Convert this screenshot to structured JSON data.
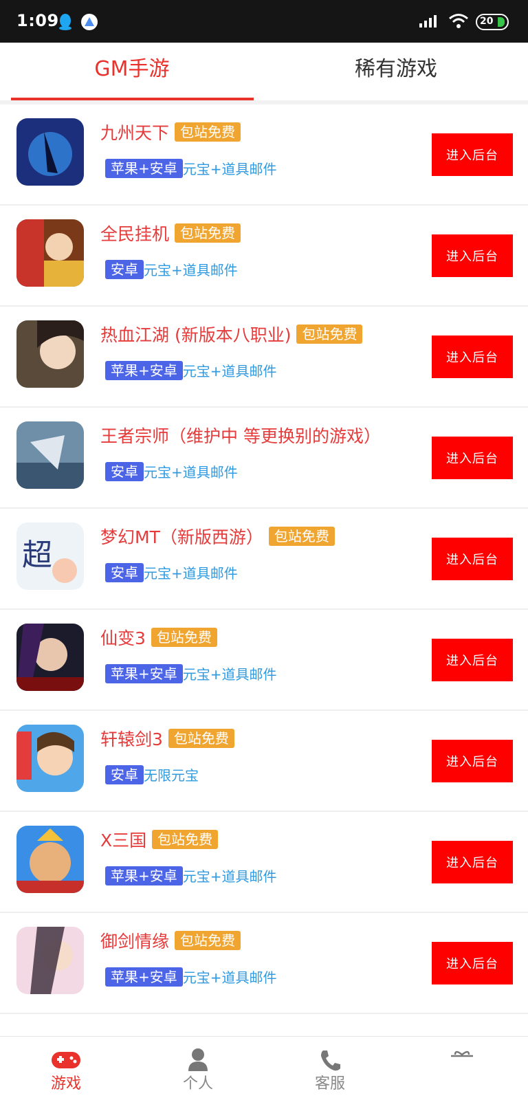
{
  "status_bar": {
    "time": "1:09",
    "battery": "20"
  },
  "tabs": [
    {
      "label": "GM手游",
      "active": true
    },
    {
      "label": "稀有游戏",
      "active": false
    }
  ],
  "colors": {
    "accent": "#e8322b",
    "title": "#e53b3b",
    "free_badge": "#f0a531",
    "platform_badge": "#4c64e6",
    "perks": "#2f9ae0",
    "button": "#ff0000"
  },
  "games": [
    {
      "title": "九州天下",
      "badge": "包站免费",
      "platform": "苹果+安卓",
      "perks": "元宝+道具邮件",
      "button": "进入后台"
    },
    {
      "title": "全民挂机",
      "badge": "包站免费",
      "platform": "安卓",
      "perks": "元宝+道具邮件",
      "button": "进入后台"
    },
    {
      "title": "热血江湖 (新版本八职业)",
      "badge": "包站免费",
      "platform": "苹果+安卓",
      "perks": "元宝+道具邮件",
      "button": "进入后台"
    },
    {
      "title": "王者宗师（维护中 等更换别的游戏）",
      "badge": "",
      "platform": "安卓",
      "perks": "元宝+道具邮件",
      "button": "进入后台"
    },
    {
      "title": "梦幻MT（新版西游）",
      "badge": "包站免费",
      "platform": "安卓",
      "perks": "元宝+道具邮件",
      "button": "进入后台"
    },
    {
      "title": "仙变3",
      "badge": "包站免费",
      "platform": "苹果+安卓",
      "perks": "元宝+道具邮件",
      "button": "进入后台"
    },
    {
      "title": "轩辕剑3",
      "badge": "包站免费",
      "platform": "安卓",
      "perks": "无限元宝",
      "button": "进入后台"
    },
    {
      "title": "X三国",
      "badge": "包站免费",
      "platform": "苹果+安卓",
      "perks": "元宝+道具邮件",
      "button": "进入后台"
    },
    {
      "title": "御剑情缘",
      "badge": "包站免费",
      "platform": "苹果+安卓",
      "perks": "元宝+道具邮件",
      "button": "进入后台"
    }
  ],
  "bottom_nav": [
    {
      "label": "游戏",
      "icon": "gamepad-icon",
      "active": true
    },
    {
      "label": "个人",
      "icon": "person-icon",
      "active": false
    },
    {
      "label": "客服",
      "icon": "phone-icon",
      "active": false
    },
    {
      "label": "",
      "icon": "gift-icon",
      "active": false
    }
  ]
}
